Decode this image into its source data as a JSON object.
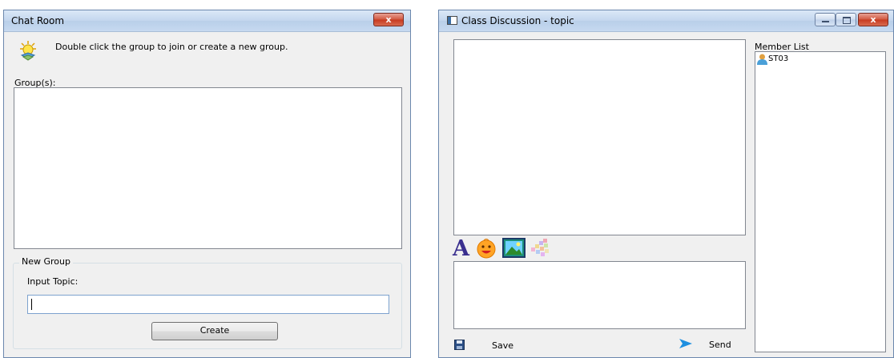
{
  "chat_room": {
    "title": "Chat Room",
    "close_label": "x",
    "hint": "Double click the group to join or create a new group.",
    "groups_label": "Group(s):",
    "groups": [],
    "new_group_legend": "New Group",
    "input_topic_label": "Input Topic:",
    "input_topic_value": "",
    "create_button": "Create"
  },
  "class_discussion": {
    "title": "Class Discussion - topic",
    "member_list_label": "Member List",
    "members": [
      {
        "name": "ST03",
        "icon": "user-icon"
      }
    ],
    "toolbar_icons": [
      "font-icon",
      "emoticon-icon",
      "picture-icon",
      "color-palette-icon"
    ],
    "save_label": "Save",
    "send_label": "Send",
    "message_value": ""
  },
  "colors": {
    "title_bar": "#c6d9f0",
    "close_button": "#c7391f",
    "font_icon": "#3a2f8f",
    "member_icon": "#e0a040"
  }
}
